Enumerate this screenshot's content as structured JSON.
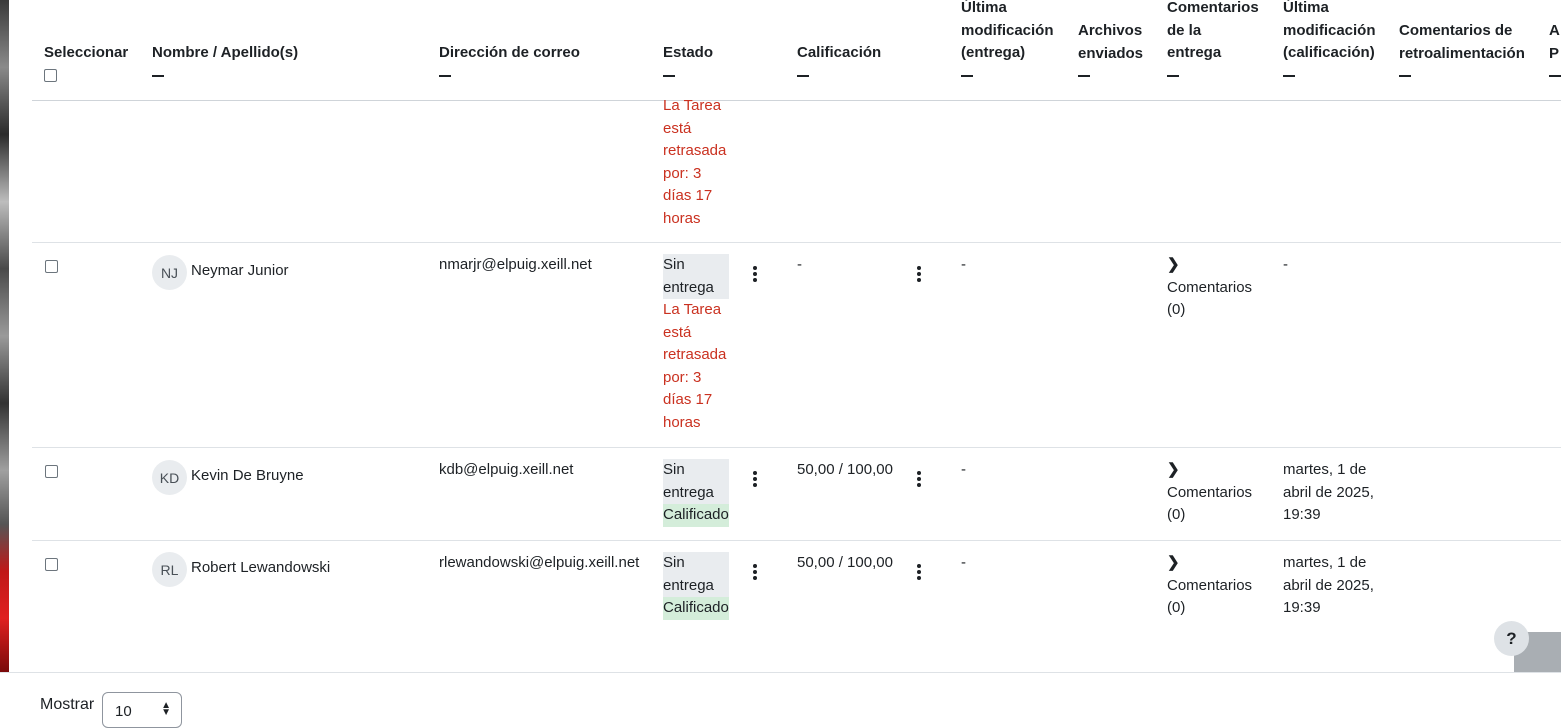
{
  "headers": {
    "select": "Seleccionar",
    "name": "Nombre / Apellido(s)",
    "email": "Dirección de correo",
    "status": "Estado",
    "grade": "Calificación",
    "last_mod_sub_1": "Última",
    "last_mod_sub_2": "modificación",
    "last_mod_sub_3": "(entrega)",
    "files_1": "Archivos",
    "files_2": "enviados",
    "sub_comments_1": "Comentarios",
    "sub_comments_2": "de la",
    "sub_comments_3": "entrega",
    "last_mod_grade_1": "Última",
    "last_mod_grade_2": "modificación",
    "last_mod_grade_3": "(calificación)",
    "feedback_1": "Comentarios de",
    "feedback_2": "retroalimentación",
    "next_col_1": "A",
    "next_col_2": "P"
  },
  "partial_row": {
    "late_lines": [
      "La Tarea",
      "está",
      "retrasada",
      "por: 3",
      "días 17",
      "horas"
    ]
  },
  "rows": [
    {
      "initials": "NJ",
      "name": "Neymar Junior",
      "email": "nmarjr@elpuig.xeill.net",
      "status_1": "Sin",
      "status_2": "entrega",
      "late_lines": [
        "La Tarea",
        "está",
        "retrasada",
        "por: 3",
        "días 17",
        "horas"
      ],
      "grade": "-",
      "last_mod_sub": "-",
      "comments_1": "Comentarios",
      "comments_2": "(0)",
      "last_mod_grade": "-"
    },
    {
      "initials": "KD",
      "name": "Kevin De Bruyne",
      "email": "kdb@elpuig.xeill.net",
      "status_1": "Sin",
      "status_2": "entrega",
      "graded": "Calificado",
      "grade": "50,00 / 100,00",
      "last_mod_sub": "-",
      "comments_1": "Comentarios",
      "comments_2": "(0)",
      "last_mod_grade_1": "martes, 1 de",
      "last_mod_grade_2": "abril de 2025,",
      "last_mod_grade_3": "19:39"
    },
    {
      "initials": "RL",
      "name": "Robert Lewandowski",
      "email": "rlewandowski@elpuig.xeill.net",
      "status_1": "Sin",
      "status_2": "entrega",
      "graded": "Calificado",
      "grade": "50,00 / 100,00",
      "last_mod_sub": "-",
      "comments_1": "Comentarios",
      "comments_2": "(0)",
      "last_mod_grade_1": "martes, 1 de",
      "last_mod_grade_2": "abril de 2025,",
      "last_mod_grade_3": "19:39"
    }
  ],
  "help_button": "?",
  "footer": {
    "show_label": "Mostrar",
    "per_page_value": "10"
  }
}
